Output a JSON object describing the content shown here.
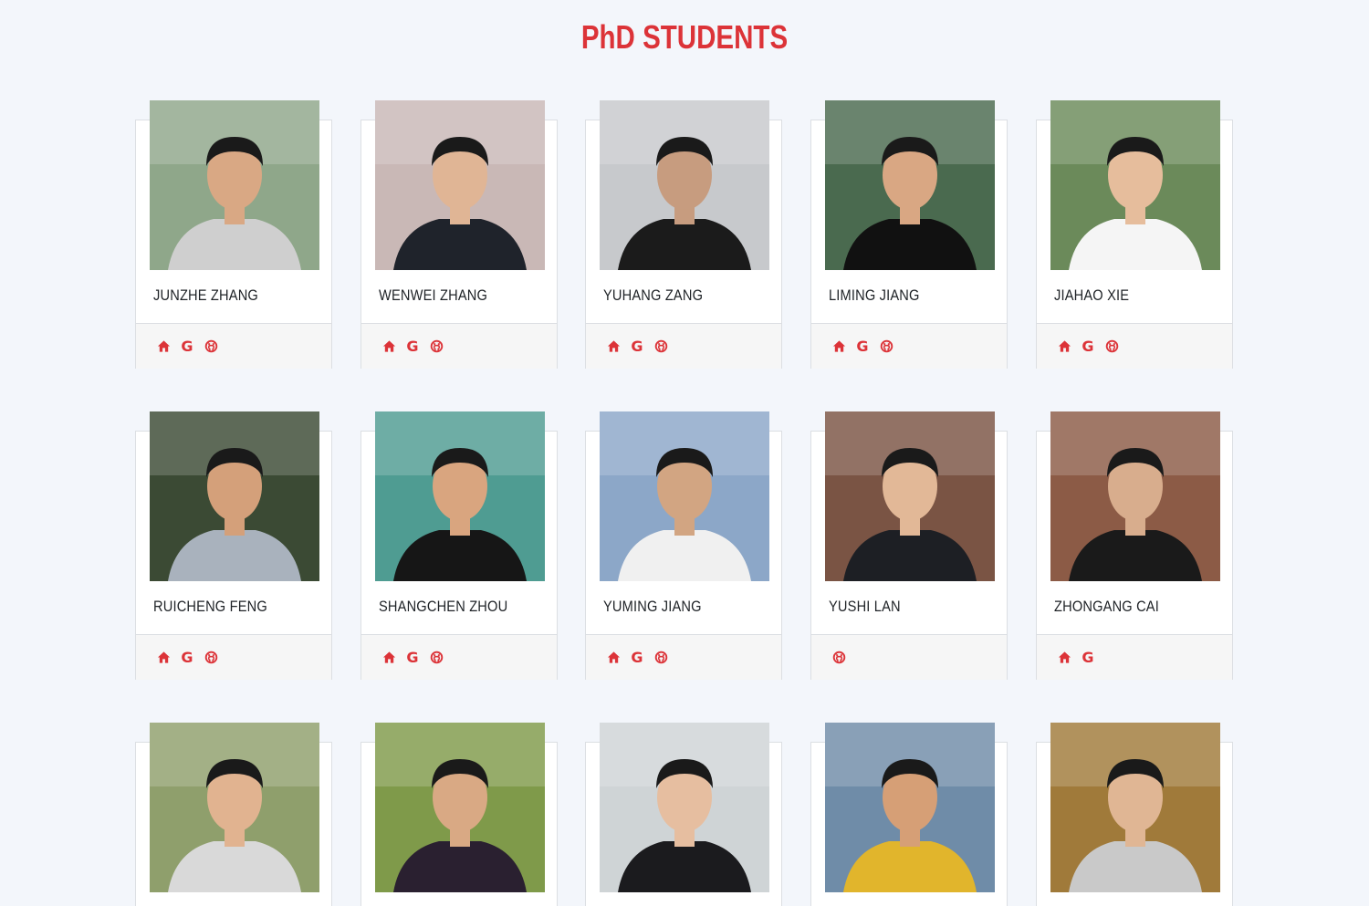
{
  "page": {
    "title": "PhD STUDENTS"
  },
  "colors": {
    "accent": "#dc3338",
    "background": "#f3f6fb",
    "card": "#ffffff",
    "footer": "#f6f6f6"
  },
  "students": [
    {
      "name": "JUNZHE ZHANG",
      "links": [
        "homepage-icon",
        "google-scholar-icon",
        "github-icon"
      ],
      "photo": {
        "bg": "#8fa78a",
        "shirt": "#cfcfcf",
        "skin": "#d9a884"
      }
    },
    {
      "name": "WENWEI ZHANG",
      "links": [
        "homepage-icon",
        "google-scholar-icon",
        "github-icon"
      ],
      "photo": {
        "bg": "#c9b8b6",
        "shirt": "#1f232b",
        "skin": "#e0b595"
      }
    },
    {
      "name": "YUHANG ZANG",
      "links": [
        "homepage-icon",
        "google-scholar-icon",
        "github-icon"
      ],
      "photo": {
        "bg": "#c7c9cc",
        "shirt": "#1b1b1b",
        "skin": "#c79c7f"
      }
    },
    {
      "name": "LIMING JIANG",
      "links": [
        "homepage-icon",
        "google-scholar-icon",
        "github-icon"
      ],
      "photo": {
        "bg": "#4a6a4f",
        "shirt": "#111111",
        "skin": "#d9a783"
      }
    },
    {
      "name": "JIAHAO XIE",
      "links": [
        "homepage-icon",
        "google-scholar-icon",
        "github-icon"
      ],
      "photo": {
        "bg": "#6b8a5a",
        "shirt": "#f5f5f5",
        "skin": "#e6bd9c"
      }
    },
    {
      "name": "RUICHENG FENG",
      "links": [
        "homepage-icon",
        "google-scholar-icon",
        "github-icon"
      ],
      "photo": {
        "bg": "#3b4a34",
        "shirt": "#a9b2bd",
        "skin": "#d4a07a"
      }
    },
    {
      "name": "SHANGCHEN ZHOU",
      "links": [
        "homepage-icon",
        "google-scholar-icon",
        "github-icon"
      ],
      "photo": {
        "bg": "#4f9c92",
        "shirt": "#161616",
        "skin": "#d9a57f"
      }
    },
    {
      "name": "YUMING JIANG",
      "links": [
        "homepage-icon",
        "google-scholar-icon",
        "github-icon"
      ],
      "photo": {
        "bg": "#8ca7c8",
        "shirt": "#f0f0f0",
        "skin": "#d2a582"
      }
    },
    {
      "name": "YUSHI LAN",
      "links": [
        "github-icon"
      ],
      "photo": {
        "bg": "#7a5444",
        "shirt": "#1d1f24",
        "skin": "#e2b897"
      }
    },
    {
      "name": "ZHONGANG CAI",
      "links": [
        "homepage-icon",
        "google-scholar-icon"
      ],
      "photo": {
        "bg": "#8c5b46",
        "shirt": "#1a1a1a",
        "skin": "#d8ad8d"
      }
    },
    {
      "name": "",
      "links": [],
      "photo": {
        "bg": "#8f9f6c",
        "shirt": "#d9d9d9",
        "skin": "#e1b390"
      }
    },
    {
      "name": "",
      "links": [],
      "photo": {
        "bg": "#7f9a4a",
        "shirt": "#2a2030",
        "skin": "#d9a984"
      }
    },
    {
      "name": "",
      "links": [],
      "photo": {
        "bg": "#cfd4d6",
        "shirt": "#1b1b1e",
        "skin": "#e6bea0"
      }
    },
    {
      "name": "",
      "links": [],
      "photo": {
        "bg": "#6f8ca8",
        "shirt": "#e1b52c",
        "skin": "#d69f76"
      }
    },
    {
      "name": "",
      "links": [],
      "photo": {
        "bg": "#a07a3a",
        "shirt": "#c9c9c9",
        "skin": "#e0b694"
      }
    }
  ]
}
